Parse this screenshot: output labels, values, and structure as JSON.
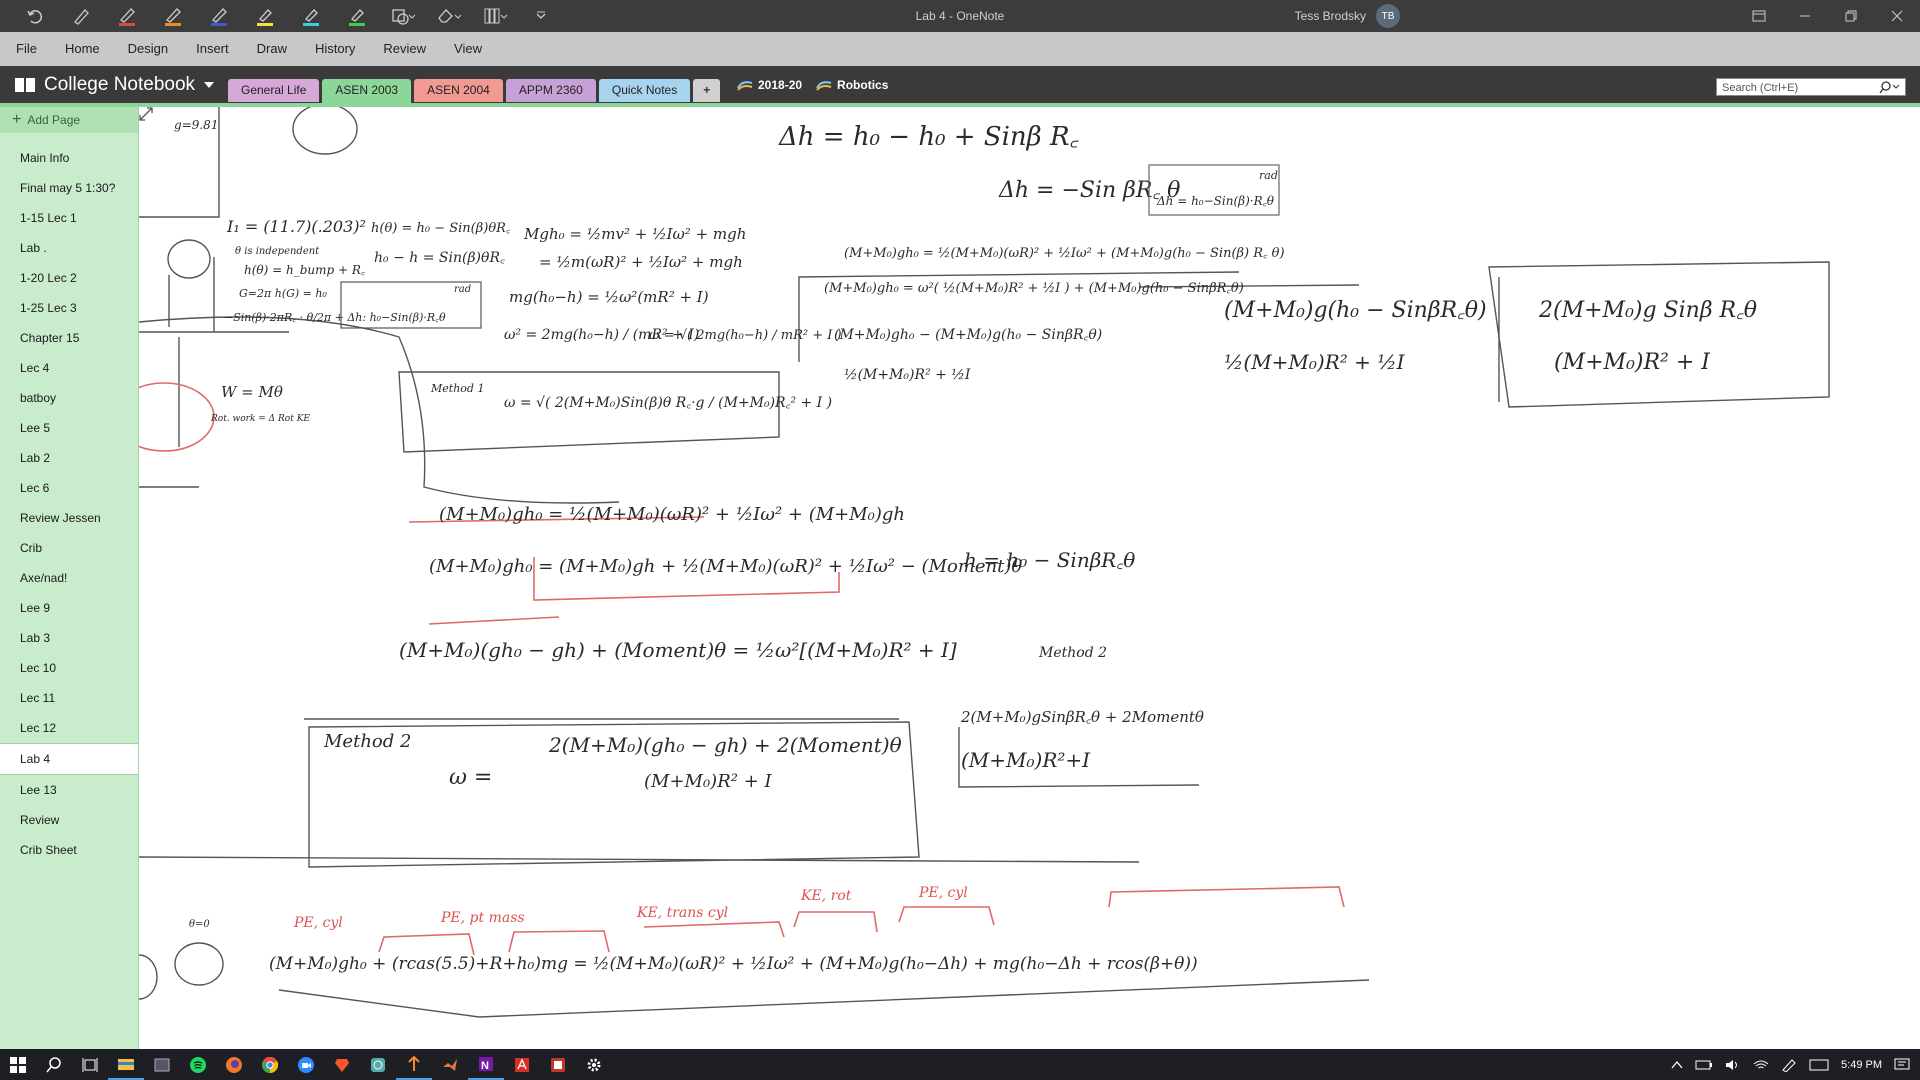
{
  "window": {
    "title": "Lab 4  -  OneNote"
  },
  "user": {
    "name": "Tess Brodsky",
    "initials": "TB"
  },
  "menu": [
    "File",
    "Home",
    "Design",
    "Insert",
    "Draw",
    "History",
    "Review",
    "View"
  ],
  "notebook": {
    "name": "College Notebook",
    "sections": [
      {
        "label": "General Life",
        "color": "#d6a8d8"
      },
      {
        "label": "ASEN 2003",
        "color": "#8dd699"
      },
      {
        "label": "ASEN 2004",
        "color": "#f19a94"
      },
      {
        "label": "APPM 2360",
        "color": "#c7a0d8"
      },
      {
        "label": "Quick Notes",
        "color": "#a8d3ef"
      }
    ],
    "add_section": "+",
    "groups": [
      "2018-20",
      "Robotics"
    ],
    "search_placeholder": "Search (Ctrl+E)"
  },
  "pages": {
    "add_label": "Add Page",
    "active": "Lab 4",
    "items": [
      "Main Info",
      "Final may 5 1:30?",
      "1-15 Lec 1",
      "Lab .",
      "1-20 Lec 2",
      "1-25 Lec 3",
      "Chapter 15",
      "Lec 4",
      "batboy",
      "Lee 5",
      "Lab 2",
      "Lec 6",
      "Review Jessen",
      "Crib",
      "Axe/nad!",
      "Lee 9",
      "Lab 3",
      "Lec 10",
      "Lec 11",
      "Lec 12",
      "Lab 4",
      "Lee 13",
      "Review",
      "Crib Sheet"
    ]
  },
  "ink": {
    "eq_dh": "Δh = h₀ − h₀ + Sinβ R꜀",
    "eq_dh2": "Δh = −Sin βR꜀ θ",
    "rad1": "rad",
    "rad_box": "Δh = h₀−Sin(β)·R꜀θ",
    "inertia": "I₁ = (11.7)(.203)²",
    "theta_indep": "θ is independent",
    "h_theta": "h(θ) = h_bump + R꜀",
    "g_theta": "G=2π  h(G) = h₀",
    "sin_line": "−Sin(β)·2πR꜀ · θ/2π + Δh: h₀−Sin(β)·R꜀θ",
    "h_eq1": "h(θ) = h₀ − Sin(β)θR꜀",
    "h_eq2": "h₀ − h = Sin(β)θR꜀",
    "rad2": "rad",
    "energy1": "Mgh₀ = ½mv² + ½Iω² + mgh",
    "energy2": "= ½m(ωR)² + ½Iω² + mgh",
    "energy3": "mg(h₀−h) = ½ω²(mR² + I)",
    "omega_sq": "ω² = 2mg(h₀−h) / (mR² + I)",
    "omega": "ω = √( 2mg(h₀−h) / mR² + I )",
    "work1": "W = Mθ",
    "work2": "Rot. work = Δ Rot KE",
    "method1_label": "Method 1",
    "method1_eq": "ω = √( 2(M+M₀)Sin(β)θ R꜀·g / (M+M₀)R꜀² + I )",
    "big1": "(M+M₀)gh₀ = ½(M+M₀)(ωR)² + ½Iω² + (M+M₀)g(h₀ − Sin(β) R꜀ θ)",
    "big2": "(M+M₀)gh₀ = ω²( ½(M+M₀)R² + ½I ) + (M+M₀)g(h₀ − SinβR꜀θ)",
    "frac_num": "(M+M₀)gh₀ − (M+M₀)g(h₀ − SinβR꜀θ)",
    "frac_den": "½(M+M₀)R² + ½I",
    "frac2_num": "(M+M₀)g(h₀ − SinβR꜀θ)",
    "frac2_den": "½(M+M₀)R² + ½I",
    "final_num": "2(M+M₀)g  Sinβ R꜀θ",
    "final_den": "(M+M₀)R² + I",
    "cons1": "(M+M₀)gh₀ = ½(M+M₀)(ωR)² + ½Iω² + (M+M₀)gh",
    "cons2": "(M+M₀)gh₀ = (M+M₀)gh + ½(M+M₀)(ωR)² + ½Iω² − (Moment)θ",
    "h_rel": "h = h₀ − SinβR꜀θ",
    "cons3": "(M+M₀)(gh₀ − gh) + (Moment)θ = ½ω²[(M+M₀)R² + I]",
    "method2_side": "Method 2",
    "method2_label": "Method 2",
    "method2_num": "2(M+M₀)(gh₀ − gh) + 2(Moment)θ",
    "method2_den": "(M+M₀)R² + I",
    "omega_eq": "ω =",
    "method2_res_num": "2(M+M₀)gSinβR꜀θ + 2Momentθ",
    "method2_res_den": "(M+M₀)R²+I",
    "pe_cyl": "PE, cyl",
    "pe_pt": "PE, pt mass",
    "ke_trans": "KE, trans cyl",
    "ke_rot": "KE, rot",
    "pe_cyl2": "PE, cyl",
    "bottom_eq": "(M+M₀)gh₀ + (rcas(5.5)+R+h₀)mg = ½(M+M₀)(ωR)² + ½Iω² + (M+M₀)g(h₀−Δh) + mg(h₀−Δh + rcos(β+θ))",
    "theta0": "θ=0",
    "g_val": "g=9.81"
  },
  "taskbar": {
    "time": "5:49 PM"
  }
}
